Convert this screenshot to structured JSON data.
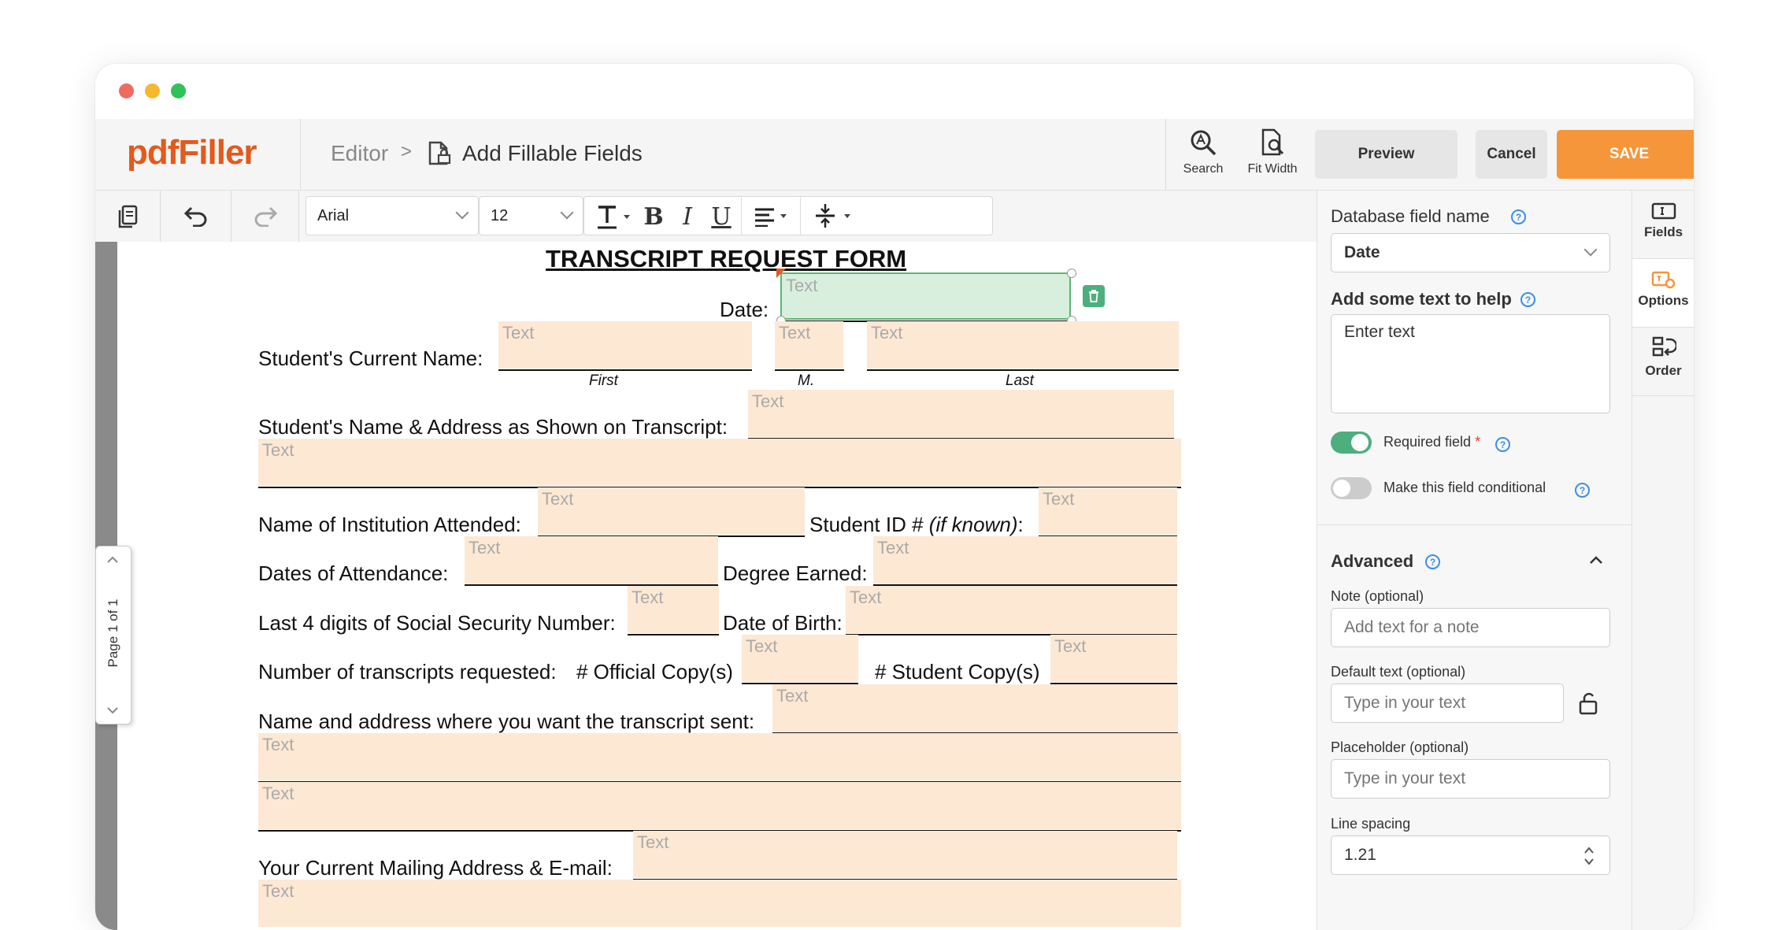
{
  "app": {
    "logo": "pdfFiller"
  },
  "breadcrumb": {
    "editor": "Editor",
    "separator": ">",
    "current": "Add Fillable Fields"
  },
  "header": {
    "search_label": "Search",
    "fit_width_label": "Fit Width",
    "preview_label": "Preview",
    "cancel_label": "Cancel",
    "save_label": "SAVE"
  },
  "toolbar": {
    "font": "Arial",
    "size": "12"
  },
  "pager": {
    "text": "Page 1 of 1"
  },
  "form": {
    "title": "TRANSCRIPT REQUEST FORM",
    "field_placeholder": "Text",
    "date_label": "Date:",
    "current_name_label": "Student's Current Name:",
    "first": "First",
    "middle": "M.",
    "last": "Last",
    "name_address_label": "Student's Name & Address as Shown on Transcript:",
    "institution_label": "Name of Institution Attended:",
    "student_id_label": "Student ID #",
    "if_known": "(if known)",
    "colon": ":",
    "dates_label": "Dates of Attendance:",
    "degree_label": "Degree Earned:",
    "ssn_label": "Last 4 digits of Social Security Number:",
    "dob_label": "Date of Birth:",
    "num_transcripts_label": "Number of transcripts requested:",
    "official_label": "# Official Copy(s)",
    "student_copy_label": "# Student Copy(s)",
    "send_to_label": "Name and address where you want the transcript sent:",
    "mailing_label": "Your Current Mailing Address & E-mail:"
  },
  "panel": {
    "db_field_label": "Database field name",
    "db_field_value": "Date",
    "help_text_label": "Add some text to help",
    "help_text_value": "Enter text",
    "required_label": "Required field",
    "required_star": "*",
    "conditional_label": "Make this field conditional",
    "advanced_label": "Advanced",
    "note_label": "Note (optional)",
    "note_placeholder": "Add text for a note",
    "default_label": "Default text (optional)",
    "default_placeholder": "Type in your text",
    "placeholder_label": "Placeholder (optional)",
    "placeholder_placeholder": "Type in your text",
    "line_spacing_label": "Line spacing",
    "line_spacing_value": "1.21"
  },
  "rail": {
    "fields": "Fields",
    "options": "Options",
    "order": "Order"
  },
  "colors": {
    "accent": "#f5963a",
    "brand": "#e25a1c",
    "toggle_on": "#4caf7d",
    "field_bg": "#fde8d4",
    "active_field": "#d8efdd"
  }
}
